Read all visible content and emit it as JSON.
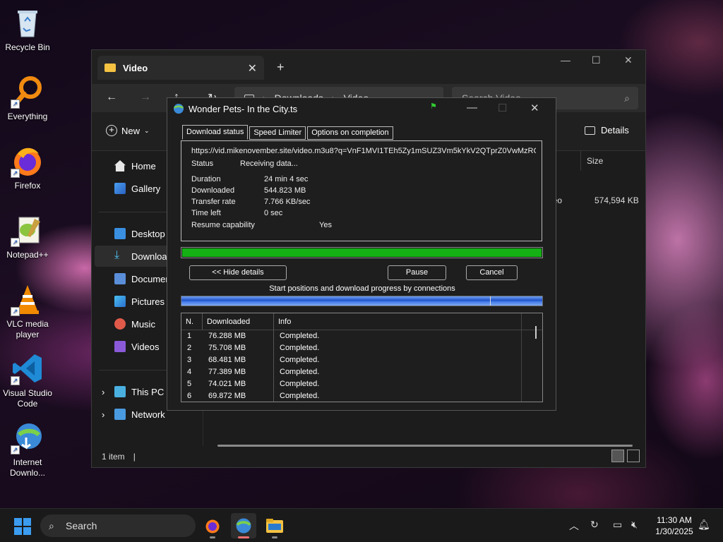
{
  "desktop": {
    "icons": [
      {
        "label": "Recycle Bin"
      },
      {
        "label": "Everything"
      },
      {
        "label": "Firefox"
      },
      {
        "label": "Notepad++"
      },
      {
        "label": "VLC media player"
      },
      {
        "label": "Visual Studio Code"
      },
      {
        "label": "Internet Downlo..."
      }
    ]
  },
  "explorer": {
    "tab_title": "Video",
    "breadcrumb": [
      "Downloads",
      "Video"
    ],
    "search_placeholder": "Search Video",
    "new_label": "New",
    "details_label": "Details",
    "sidebar": {
      "home": "Home",
      "gallery": "Gallery",
      "desktop": "Desktop",
      "downloads": "Downloads",
      "documents": "Documents",
      "pictures": "Pictures",
      "music": "Music",
      "videos": "Videos",
      "this_pc": "This PC",
      "network": "Network"
    },
    "column_size": "Size",
    "row_type_fragment": "deo",
    "row_size": "574,594 KB",
    "status": "1 item"
  },
  "idm": {
    "title": "Wonder Pets- In the City.ts",
    "tabs": [
      "Download status",
      "Speed Limiter",
      "Options on completion"
    ],
    "url": "https://vid.mikenovember.site/video.m3u8?q=VnF1MVI1TEh5Zy1mSUZ3Vm5kYkV2QTprZ0VwMzRCYV",
    "status_label": "Status",
    "status_value": "Receiving data...",
    "duration_label": "Duration",
    "duration_value": "24 min 4 sec",
    "downloaded_label": "Downloaded",
    "downloaded_value": "544.823  MB",
    "rate_label": "Transfer rate",
    "rate_value": "7.766  KB/sec",
    "timeleft_label": "Time left",
    "timeleft_value": "0 sec",
    "resume_label": "Resume capability",
    "resume_value": "Yes",
    "progress_fraction": 1.0,
    "hide_details_label": "<< Hide details",
    "pause_label": "Pause",
    "cancel_label": "Cancel",
    "connections_caption": "Start positions and download progress by connections",
    "connections_header": [
      "N.",
      "Downloaded",
      "Info"
    ],
    "connections": [
      {
        "n": "1",
        "downloaded": "76.288  MB",
        "info": "Completed."
      },
      {
        "n": "2",
        "downloaded": "75.708  MB",
        "info": "Completed."
      },
      {
        "n": "3",
        "downloaded": "68.481  MB",
        "info": "Completed."
      },
      {
        "n": "4",
        "downloaded": "77.389  MB",
        "info": "Completed."
      },
      {
        "n": "5",
        "downloaded": "74.021  MB",
        "info": "Completed."
      },
      {
        "n": "6",
        "downloaded": "69.872  MB",
        "info": "Completed."
      }
    ]
  },
  "taskbar": {
    "search_placeholder": "Search",
    "time": "11:30 AM",
    "date": "1/30/2025"
  },
  "colors": {
    "progress_fill": "#14b014",
    "accent": "#3b9cf0"
  }
}
